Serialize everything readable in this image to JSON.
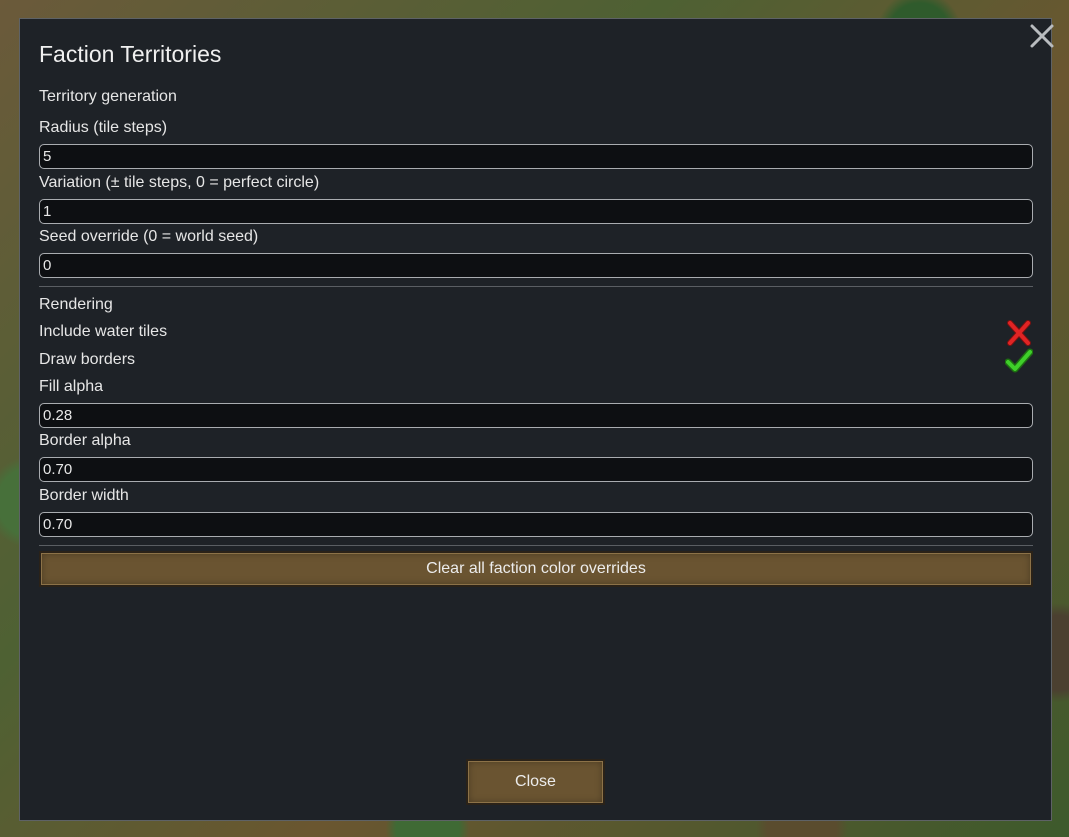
{
  "dialog": {
    "title": "Faction Territories",
    "close_icon": "close-icon"
  },
  "territory": {
    "heading": "Territory generation",
    "radius_label": "Radius (tile steps)",
    "radius_value": "5",
    "variation_label": "Variation (± tile steps, 0 = perfect circle)",
    "variation_value": "1",
    "seed_label": "Seed override (0 = world seed)",
    "seed_value": "0"
  },
  "rendering": {
    "heading": "Rendering",
    "include_water_label": "Include water tiles",
    "include_water_checked": false,
    "include_water_icon": "cross-icon",
    "draw_borders_label": "Draw borders",
    "draw_borders_checked": true,
    "draw_borders_icon": "checkmark-icon",
    "fill_alpha_label": "Fill alpha",
    "fill_alpha_value": "0.28",
    "border_alpha_label": "Border alpha",
    "border_alpha_value": "0.70",
    "border_width_label": "Border width",
    "border_width_value": "0.70"
  },
  "buttons": {
    "clear_overrides_label": "Clear all faction color overrides",
    "close_label": "Close"
  },
  "colors": {
    "window_bg": "#1e2227",
    "button_bg": "#6a5431",
    "check_green": "#3fcf2a",
    "cross_red": "#e02424"
  }
}
